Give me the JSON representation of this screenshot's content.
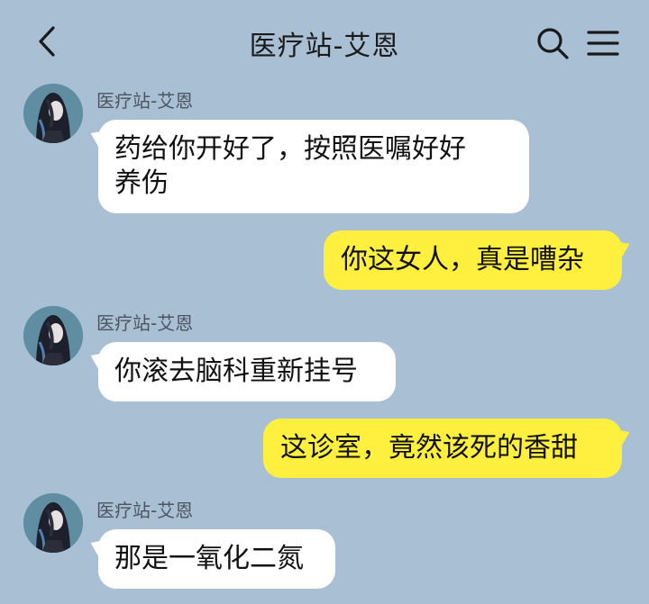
{
  "header": {
    "title": "医疗站-艾恩",
    "back_icon": "chevron-left-icon",
    "search_icon": "search-icon",
    "menu_icon": "hamburger-menu-icon"
  },
  "colors": {
    "background": "#a9bfd3",
    "incoming_bubble": "#ffffff",
    "outgoing_bubble": "#fff03f"
  },
  "messages": [
    {
      "direction": "in",
      "sender": "医疗站-艾恩",
      "lines": [
        "药给你开好了，按照医嘱好好",
        "养伤"
      ]
    },
    {
      "direction": "out",
      "text": "你这女人，真是嘈杂"
    },
    {
      "direction": "in",
      "sender": "医疗站-艾恩",
      "text": "你滚去脑科重新挂号"
    },
    {
      "direction": "out",
      "text": "这诊室，竟然该死的香甜"
    },
    {
      "direction": "in",
      "sender": "医疗站-艾恩",
      "text": "那是一氧化二氮"
    }
  ]
}
